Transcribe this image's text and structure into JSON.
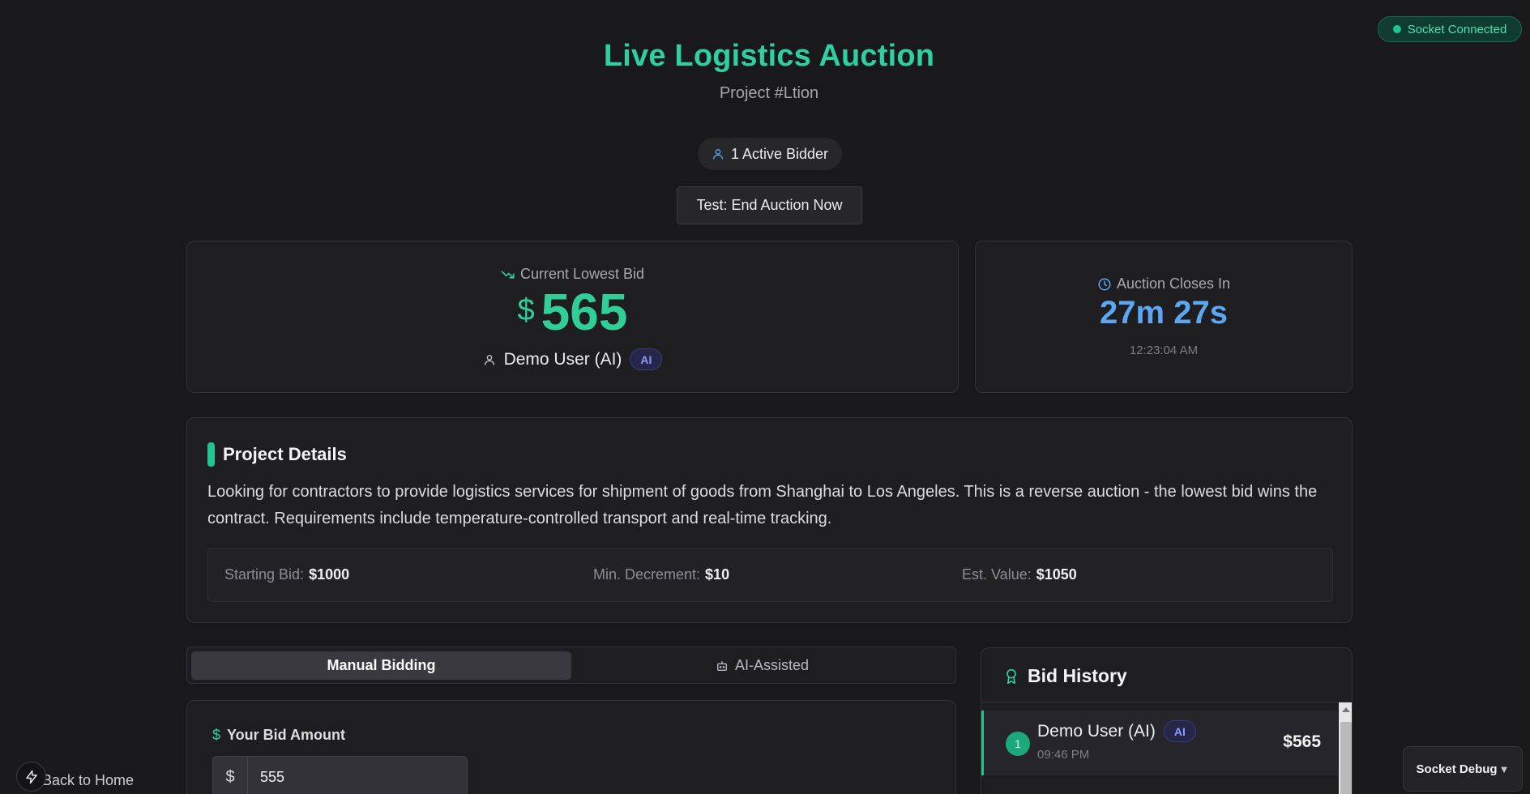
{
  "socket": {
    "status": "Socket Connected"
  },
  "header": {
    "title": "Live Logistics Auction",
    "subtitle": "Project #Ltion"
  },
  "bidders": {
    "label": "1 Active Bidder"
  },
  "test_button": {
    "label": "Test: End Auction Now"
  },
  "current_bid": {
    "label": "Current Lowest Bid",
    "currency": "$",
    "amount": "565",
    "user": "Demo User (AI)",
    "badge": "AI"
  },
  "timer": {
    "label": "Auction Closes In",
    "remaining": "27m 27s",
    "timestamp": "12:23:04 AM"
  },
  "project": {
    "title": "Project Details",
    "description": "Looking for contractors to provide logistics services for shipment of goods from Shanghai to Los Angeles. This is a reverse auction - the lowest bid wins the contract. Requirements include temperature-controlled transport and real-time tracking.",
    "stats": [
      {
        "label": "Starting Bid:",
        "value": "$1000"
      },
      {
        "label": "Min. Decrement:",
        "value": "$10"
      },
      {
        "label": "Est. Value:",
        "value": "$1050"
      }
    ]
  },
  "bidding_tabs": [
    {
      "label": "Manual Bidding",
      "active": true
    },
    {
      "label": "AI-Assisted",
      "active": false
    }
  ],
  "bid_form": {
    "label": "Your Bid Amount",
    "prefix": "$",
    "value": "555"
  },
  "history": {
    "title": "Bid History",
    "items": [
      {
        "rank": "1",
        "user": "Demo User (AI)",
        "badge": "AI",
        "time": "09:46 PM",
        "amount": "$565"
      }
    ]
  },
  "footer": {
    "back_label": "Back to Home",
    "debug_label": "Socket Debug",
    "debug_arrow": "▼"
  },
  "colors": {
    "accent": "#2fcfa2",
    "timer": "#5ba7f2",
    "background": "#19191b"
  }
}
